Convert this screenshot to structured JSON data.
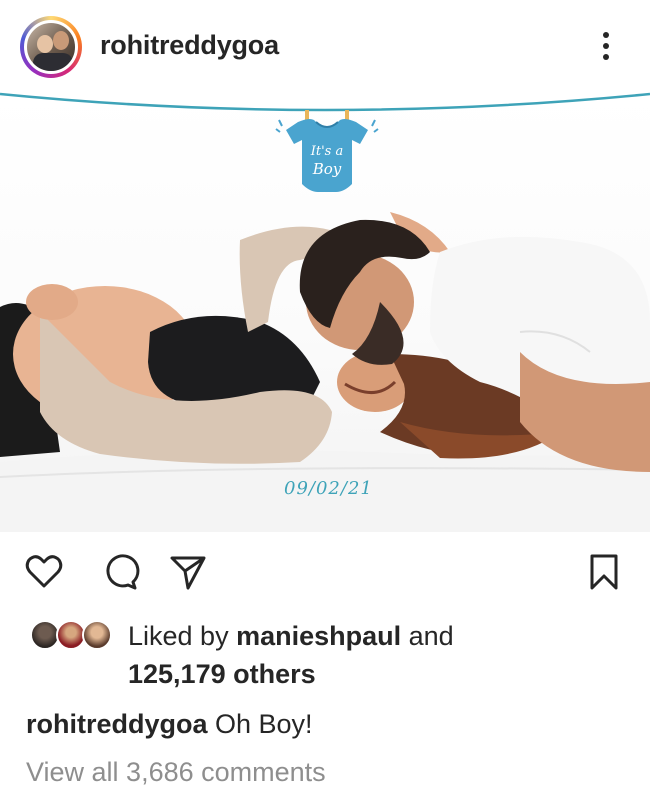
{
  "post": {
    "username": "rohitreddygoa",
    "image_text": {
      "onesie_line1": "It's a",
      "onesie_line2": "Boy",
      "date": "09/02/21"
    }
  },
  "icons": {
    "more": "more-vertical-icon",
    "like": "heart-icon",
    "comment": "comment-bubble-icon",
    "share": "paper-plane-icon",
    "save": "bookmark-icon"
  },
  "likes": {
    "prefix": "Liked by ",
    "user": "manieshpaul",
    "suffix": " and",
    "others": "125,179 others"
  },
  "caption": {
    "username": "rohitreddygoa",
    "text": " Oh Boy!"
  },
  "comments_link": "View all 3,686 comments",
  "colors": {
    "text": "#262626",
    "muted": "#8e8e8e",
    "accent_blue": "#3ea3b8"
  }
}
